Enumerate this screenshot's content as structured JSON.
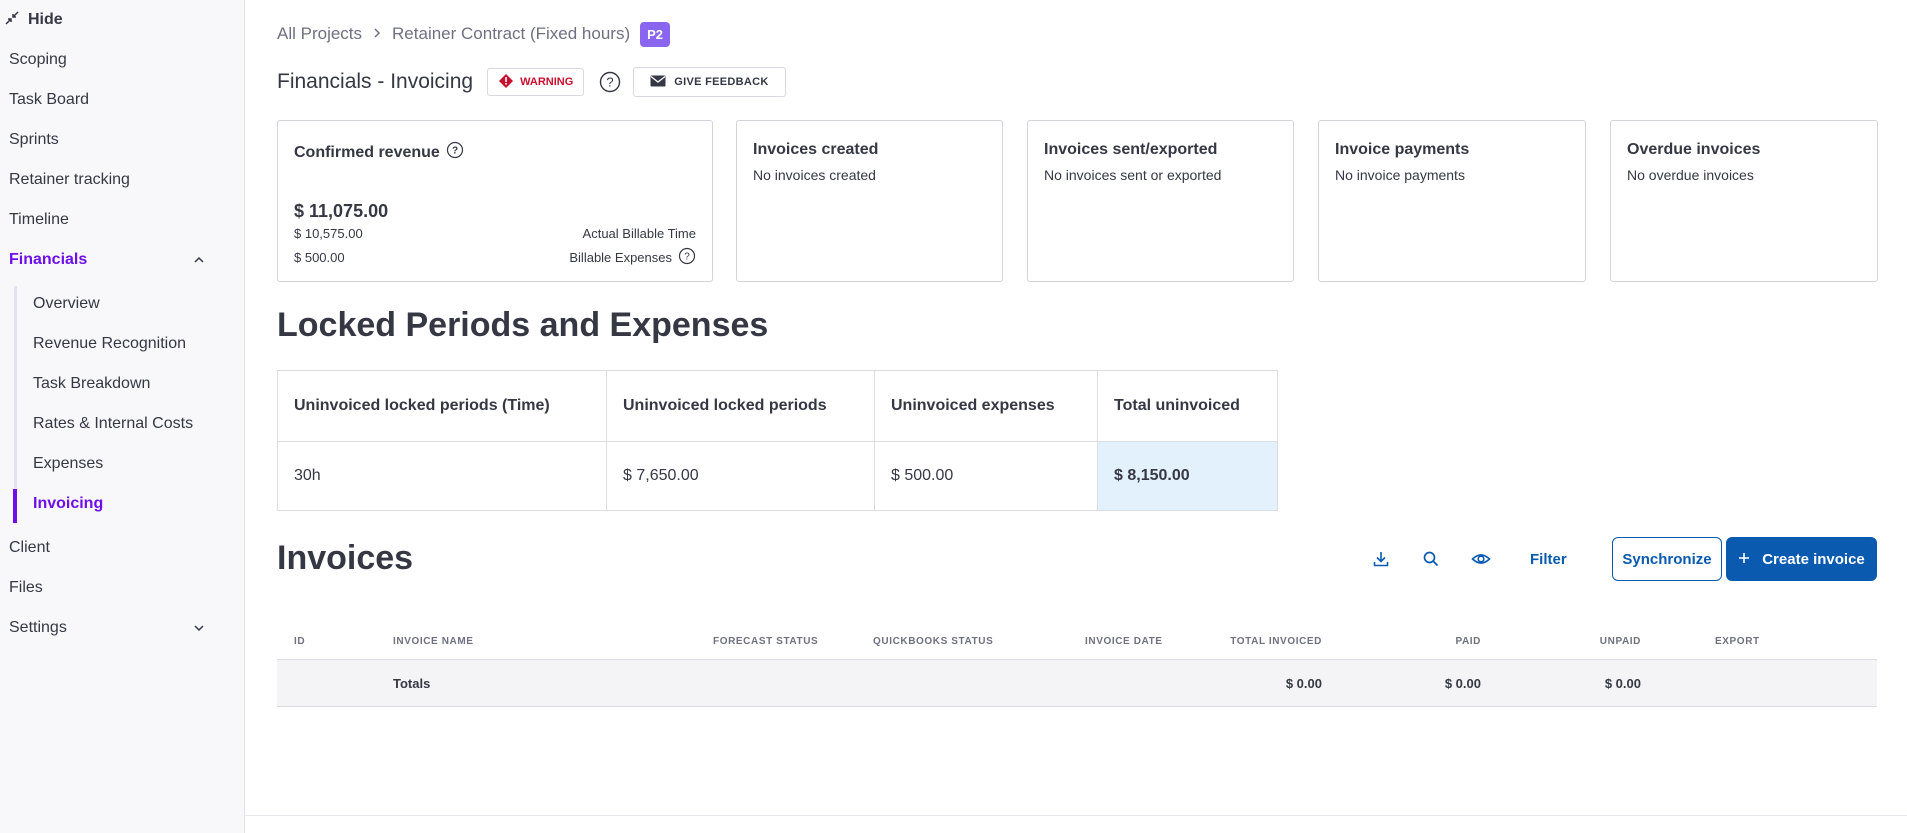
{
  "sidebar": {
    "hide_label": "Hide",
    "items": [
      {
        "label": "Scoping"
      },
      {
        "label": "Task Board"
      },
      {
        "label": "Sprints"
      },
      {
        "label": "Retainer tracking"
      },
      {
        "label": "Timeline"
      },
      {
        "label": "Financials"
      },
      {
        "label": "Client"
      },
      {
        "label": "Files"
      },
      {
        "label": "Settings"
      }
    ],
    "financials_sub": [
      {
        "label": "Overview"
      },
      {
        "label": "Revenue Recognition"
      },
      {
        "label": "Task Breakdown"
      },
      {
        "label": "Rates & Internal Costs"
      },
      {
        "label": "Expenses"
      },
      {
        "label": "Invoicing"
      }
    ],
    "active_color": "#6e0fea"
  },
  "breadcrumb": {
    "root": "All Projects",
    "project": "Retainer Contract (Fixed hours)",
    "badge": "P2"
  },
  "header": {
    "title": "Financials - Invoicing",
    "warning_label": "WARNING",
    "feedback_label": "GIVE FEEDBACK"
  },
  "cards": {
    "revenue": {
      "title": "Confirmed revenue",
      "total": "$ 11,075.00",
      "time_value": "$ 10,575.00",
      "time_label": "Actual Billable Time",
      "expenses_value": "$ 500.00",
      "expenses_label": "Billable Expenses"
    },
    "created": {
      "title": "Invoices created",
      "sub": "No invoices created"
    },
    "sent": {
      "title": "Invoices sent/exported",
      "sub": "No invoices sent or exported"
    },
    "payments": {
      "title": "Invoice payments",
      "sub": "No invoice payments"
    },
    "overdue": {
      "title": "Overdue invoices",
      "sub": "No overdue invoices"
    }
  },
  "locked": {
    "heading": "Locked Periods and Expenses",
    "headers": [
      "Uninvoiced locked periods (Time)",
      "Uninvoiced locked periods",
      "Uninvoiced expenses",
      "Total uninvoiced"
    ],
    "values": [
      "30h",
      "$ 7,650.00",
      "$ 500.00",
      "$ 8,150.00"
    ]
  },
  "invoices": {
    "heading": "Invoices",
    "filter_label": "Filter",
    "sync_label": "Synchronize",
    "create_label": "Create invoice",
    "columns": [
      "ID",
      "INVOICE NAME",
      "FORECAST STATUS",
      "QUICKBOOKS STATUS",
      "INVOICE DATE",
      "TOTAL INVOICED",
      "PAID",
      "UNPAID",
      "EXPORT"
    ],
    "totals_label": "Totals",
    "totals": {
      "invoiced": "$ 0.00",
      "paid": "$ 0.00",
      "unpaid": "$ 0.00"
    },
    "accent_color": "#0a5ab0"
  }
}
